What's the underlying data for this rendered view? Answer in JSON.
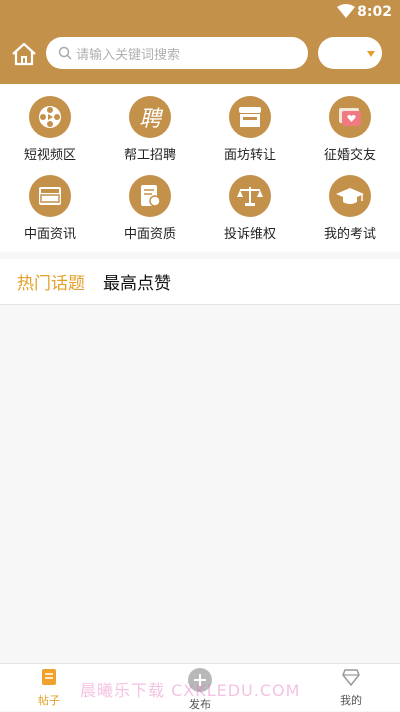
{
  "status": {
    "time": "8:02"
  },
  "search": {
    "placeholder": "请输入关键词搜索"
  },
  "categories": [
    {
      "label": "短视频区",
      "icon": "film-reel-icon"
    },
    {
      "label": "帮工招聘",
      "icon": "recruit-icon"
    },
    {
      "label": "面坊转让",
      "icon": "shop-icon"
    },
    {
      "label": "征婚交友",
      "icon": "heart-photo-icon"
    },
    {
      "label": "中面资讯",
      "icon": "news-icon"
    },
    {
      "label": "中面资质",
      "icon": "certificate-icon"
    },
    {
      "label": "投诉维权",
      "icon": "scales-icon"
    },
    {
      "label": "我的考试",
      "icon": "graduation-cap-icon"
    }
  ],
  "tabs": {
    "hot": "热门话题",
    "top": "最高点赞"
  },
  "bottom_nav": {
    "posts": "帖子",
    "publish": "发布",
    "mine": "我的"
  },
  "watermark": "晨曦乐下载 CXKLEDU.COM",
  "colors": {
    "brand": "#c4914b",
    "accent": "#e3a12c"
  }
}
